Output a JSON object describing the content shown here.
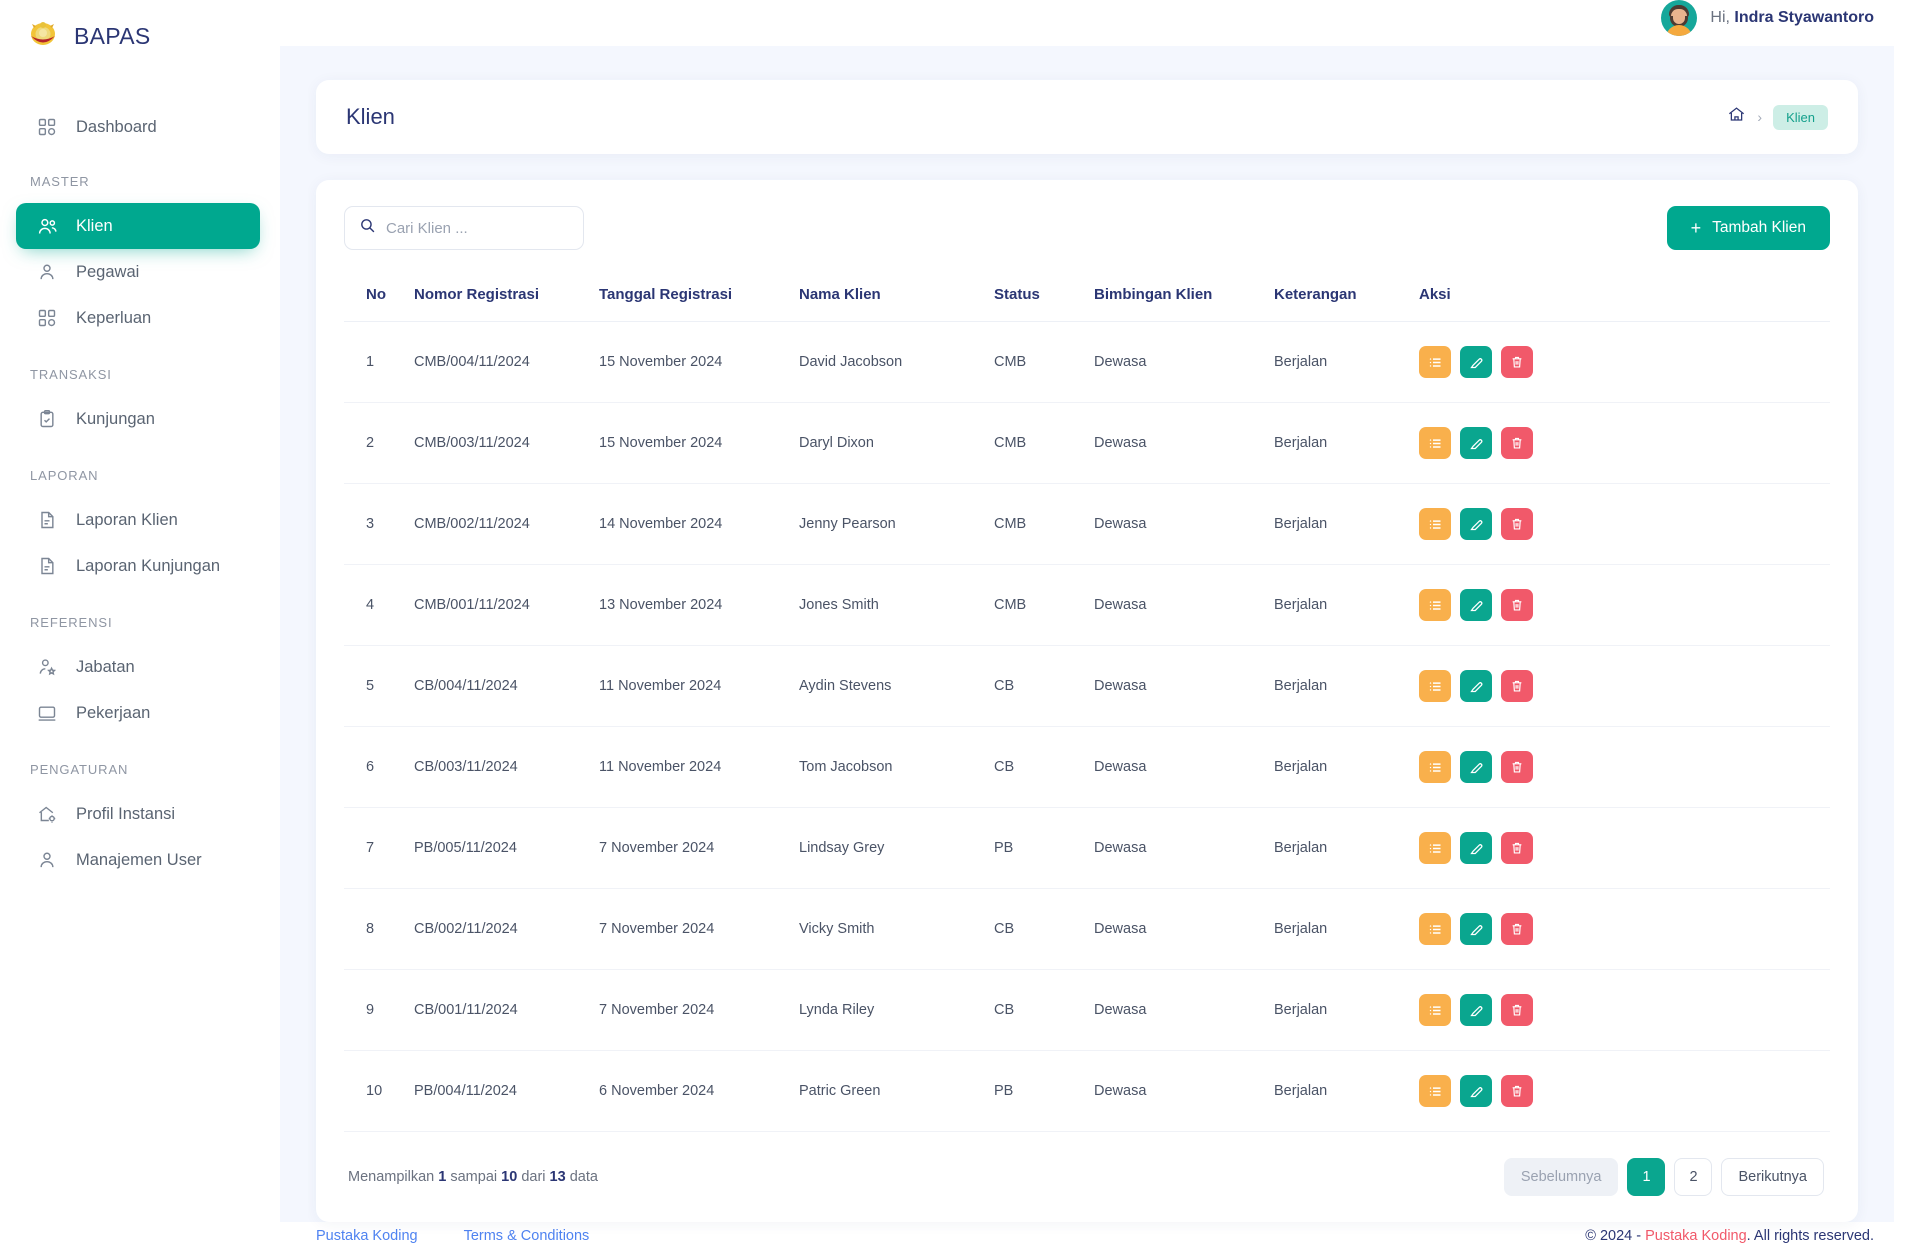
{
  "brand": {
    "name": "BAPAS",
    "logo_icon": "garuda-crest-icon",
    "menu_toggle_icon": "hamburger-icon"
  },
  "topbar": {
    "greeting_prefix": "Hi,",
    "user_name": "Indra Styawantoro",
    "avatar_icon": "user-avatar"
  },
  "sidebar": {
    "groups": [
      {
        "label": "",
        "items": [
          {
            "label": "Dashboard",
            "icon": "grid-icon",
            "active": false
          }
        ]
      },
      {
        "label": "MASTER",
        "items": [
          {
            "label": "Klien",
            "icon": "users-icon",
            "active": true
          },
          {
            "label": "Pegawai",
            "icon": "user-icon",
            "active": false
          },
          {
            "label": "Keperluan",
            "icon": "grid-icon",
            "active": false
          }
        ]
      },
      {
        "label": "TRANSAKSI",
        "items": [
          {
            "label": "Kunjungan",
            "icon": "clipboard-check-icon",
            "active": false
          }
        ]
      },
      {
        "label": "LAPORAN",
        "items": [
          {
            "label": "Laporan Klien",
            "icon": "document-icon",
            "active": false
          },
          {
            "label": "Laporan Kunjungan",
            "icon": "document-icon",
            "active": false
          }
        ]
      },
      {
        "label": "REFERENSI",
        "items": [
          {
            "label": "Jabatan",
            "icon": "user-star-icon",
            "active": false
          },
          {
            "label": "Pekerjaan",
            "icon": "monitor-icon",
            "active": false
          }
        ]
      },
      {
        "label": "PENGATURAN",
        "items": [
          {
            "label": "Profil Instansi",
            "icon": "home-gear-icon",
            "active": false
          },
          {
            "label": "Manajemen User",
            "icon": "user-icon",
            "active": false
          }
        ]
      }
    ]
  },
  "page": {
    "title": "Klien",
    "breadcrumb": {
      "home_icon": "home-icon",
      "separator": "›",
      "current": "Klien"
    }
  },
  "toolbar": {
    "search_placeholder": "Cari Klien ...",
    "search_value": "",
    "search_icon": "search-icon",
    "add_button_label": "Tambah Klien",
    "add_button_icon": "plus-icon"
  },
  "table": {
    "columns": [
      "No",
      "Nomor Registrasi",
      "Tanggal Registrasi",
      "Nama Klien",
      "Status",
      "Bimbingan Klien",
      "Keterangan",
      "Aksi"
    ],
    "rows": [
      {
        "no": "1",
        "nomor": "CMB/004/11/2024",
        "tanggal": "15 November 2024",
        "nama": "David Jacobson",
        "status": "CMB",
        "bimbingan": "Dewasa",
        "keterangan": "Berjalan"
      },
      {
        "no": "2",
        "nomor": "CMB/003/11/2024",
        "tanggal": "15 November 2024",
        "nama": "Daryl Dixon",
        "status": "CMB",
        "bimbingan": "Dewasa",
        "keterangan": "Berjalan"
      },
      {
        "no": "3",
        "nomor": "CMB/002/11/2024",
        "tanggal": "14 November 2024",
        "nama": "Jenny Pearson",
        "status": "CMB",
        "bimbingan": "Dewasa",
        "keterangan": "Berjalan"
      },
      {
        "no": "4",
        "nomor": "CMB/001/11/2024",
        "tanggal": "13 November 2024",
        "nama": "Jones Smith",
        "status": "CMB",
        "bimbingan": "Dewasa",
        "keterangan": "Berjalan"
      },
      {
        "no": "5",
        "nomor": "CB/004/11/2024",
        "tanggal": "11 November 2024",
        "nama": "Aydin Stevens",
        "status": "CB",
        "bimbingan": "Dewasa",
        "keterangan": "Berjalan"
      },
      {
        "no": "6",
        "nomor": "CB/003/11/2024",
        "tanggal": "11 November 2024",
        "nama": "Tom Jacobson",
        "status": "CB",
        "bimbingan": "Dewasa",
        "keterangan": "Berjalan"
      },
      {
        "no": "7",
        "nomor": "PB/005/11/2024",
        "tanggal": "7 November 2024",
        "nama": "Lindsay Grey",
        "status": "PB",
        "bimbingan": "Dewasa",
        "keterangan": "Berjalan"
      },
      {
        "no": "8",
        "nomor": "CB/002/11/2024",
        "tanggal": "7 November 2024",
        "nama": "Vicky Smith",
        "status": "CB",
        "bimbingan": "Dewasa",
        "keterangan": "Berjalan"
      },
      {
        "no": "9",
        "nomor": "CB/001/11/2024",
        "tanggal": "7 November 2024",
        "nama": "Lynda Riley",
        "status": "CB",
        "bimbingan": "Dewasa",
        "keterangan": "Berjalan"
      },
      {
        "no": "10",
        "nomor": "PB/004/11/2024",
        "tanggal": "6 November 2024",
        "nama": "Patric Green",
        "status": "PB",
        "bimbingan": "Dewasa",
        "keterangan": "Berjalan"
      }
    ],
    "action_icons": [
      "list-detail-icon",
      "edit-pencil-icon",
      "trash-delete-icon"
    ]
  },
  "pagination": {
    "showing_text": "Menampilkan 1 sampai 10 dari 13 data",
    "showing_parts": {
      "prefix": "Menampilkan",
      "from": "1",
      "mid": "sampai",
      "to": "10",
      "mid2": "dari",
      "total": "13",
      "suffix": "data"
    },
    "prev_label": "Sebelumnya",
    "next_label": "Berikutnya",
    "pages": [
      "1",
      "2"
    ],
    "current_page": "1"
  },
  "footer": {
    "links": [
      "Pustaka Koding",
      "Terms & Conditions"
    ],
    "copyright_prefix": "© 2024 - ",
    "copyright_brand": "Pustaka Koding",
    "copyright_suffix": ". All rights reserved."
  },
  "colors": {
    "accent": "#00a88f",
    "navy": "#2b3674",
    "bg": "#f4f7fe",
    "orange": "#f9b04c",
    "red": "#f1596a",
    "link": "#4f83f1",
    "badge_bg": "#cdeee6"
  }
}
